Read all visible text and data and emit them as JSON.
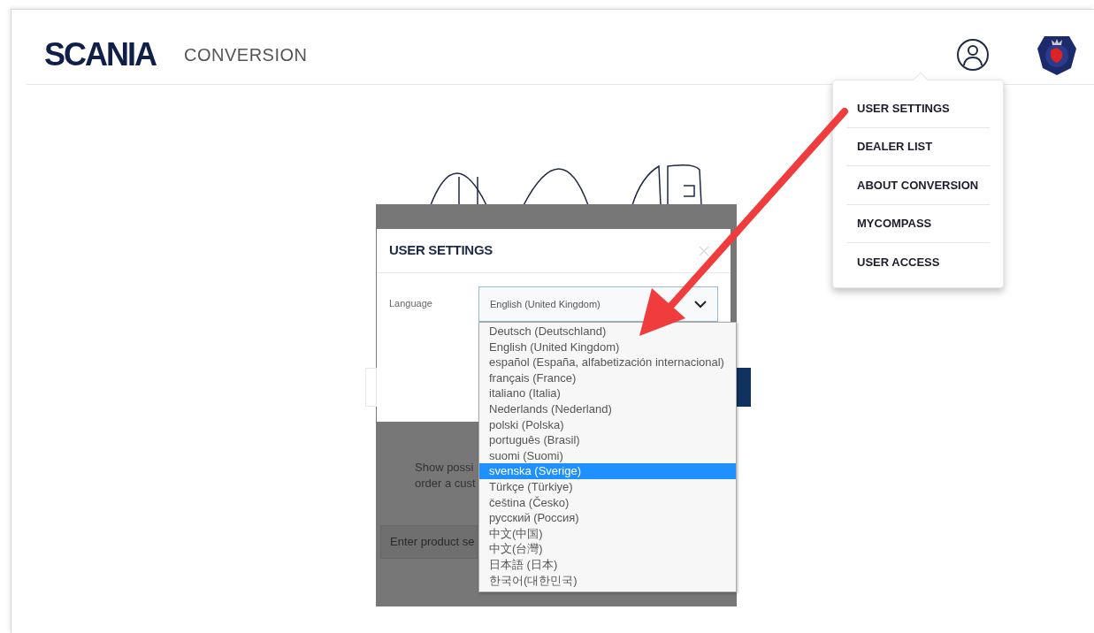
{
  "header": {
    "logo": "SCANIA",
    "app_title": "CONVERSION"
  },
  "user_menu": {
    "items": [
      {
        "label": "USER SETTINGS"
      },
      {
        "label": "DEALER LIST"
      },
      {
        "label": "ABOUT CONVERSION"
      },
      {
        "label": "MYCOMPASS"
      },
      {
        "label": "USER ACCESS"
      }
    ]
  },
  "background": {
    "description_lines": [
      "Show possi",
      "order a cust"
    ],
    "search_placeholder": "Enter product se"
  },
  "dialog": {
    "title": "USER SETTINGS",
    "language_label": "Language",
    "language_value": "English (United Kingdom)",
    "options": [
      {
        "label": "Deutsch (Deutschland)",
        "selected": false
      },
      {
        "label": "English (United Kingdom)",
        "selected": false
      },
      {
        "label": "español (España, alfabetización internacional)",
        "selected": false
      },
      {
        "label": "français (France)",
        "selected": false
      },
      {
        "label": "italiano (Italia)",
        "selected": false
      },
      {
        "label": "Nederlands (Nederland)",
        "selected": false
      },
      {
        "label": "polski (Polska)",
        "selected": false
      },
      {
        "label": "português (Brasil)",
        "selected": false
      },
      {
        "label": "suomi (Suomi)",
        "selected": false
      },
      {
        "label": "svenska (Sverige)",
        "selected": true
      },
      {
        "label": "Türkçe (Türkiye)",
        "selected": false
      },
      {
        "label": "čeština (Česko)",
        "selected": false
      },
      {
        "label": "русский (Россия)",
        "selected": false
      },
      {
        "label": "中文(中国)",
        "selected": false
      },
      {
        "label": "中文(台灣)",
        "selected": false
      },
      {
        "label": "日本語 (日本)",
        "selected": false
      },
      {
        "label": "한국어(대한민국)",
        "selected": false
      }
    ]
  }
}
